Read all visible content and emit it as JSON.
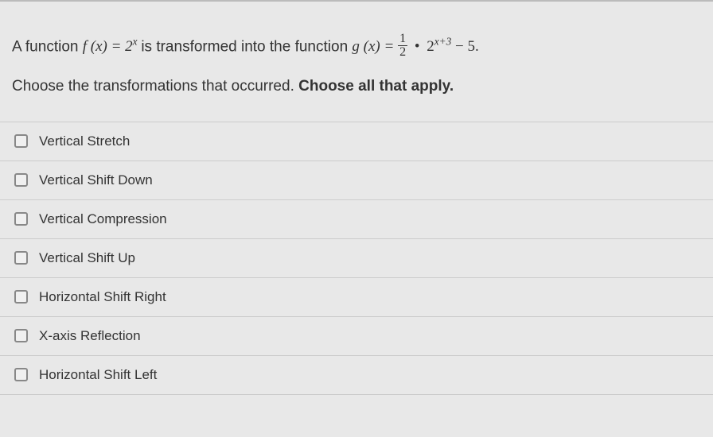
{
  "question": {
    "intro_a": "A function ",
    "f_expr": "f (x) = 2",
    "f_exp": "x",
    "mid": " is transformed into the function ",
    "g_left": "g (x) = ",
    "frac_num": "1",
    "frac_den": "2",
    "bullet": "•",
    "g_base": "2",
    "g_exp": "x+3",
    "g_tail": " − 5.",
    "line2_a": "Choose the transformations that occurred. ",
    "line2_b": "Choose all that apply."
  },
  "options": [
    {
      "label": "Vertical Stretch"
    },
    {
      "label": "Vertical Shift Down"
    },
    {
      "label": "Vertical Compression"
    },
    {
      "label": "Vertical Shift Up"
    },
    {
      "label": "Horizontal Shift Right"
    },
    {
      "label": "X-axis Reflection"
    },
    {
      "label": "Horizontal Shift Left"
    }
  ]
}
